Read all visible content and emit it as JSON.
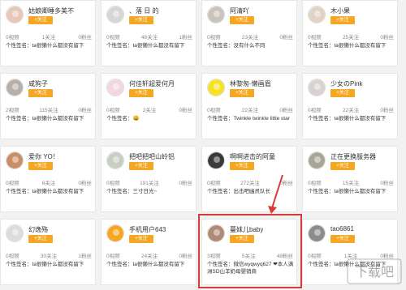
{
  "cards": [
    {
      "name": "姑娘卿睡多美不",
      "follow": "+关注",
      "views": "0视频",
      "fans": "1关注",
      "likes": "0粉丝",
      "bio": "个性签名：ta很懒什么都没有留下",
      "avatar_color": "#e8c7b8"
    },
    {
      "name": "、落 日 的",
      "follow": "+关注",
      "views": "0视频",
      "fans": "48关注",
      "likes": "1粉丝",
      "bio": "个性签名：ta很懒什么都没有留下",
      "avatar_color": "#d6d6d6"
    },
    {
      "name": "阿清吖",
      "follow": "+关注",
      "views": "0视频",
      "fans": "23关注",
      "likes": "0粉丝",
      "bio": "个性签名：没有什么不同",
      "avatar_color": "#c9c3bb"
    },
    {
      "name": "木小果",
      "follow": "+关注",
      "views": "0视频",
      "fans": "25关注",
      "likes": "0粉丝",
      "bio": "个性签名：ta很懒什么都没有留下",
      "avatar_color": "#e0d2c4"
    },
    {
      "name": "咸狗子",
      "follow": "+关注",
      "views": "2视频",
      "fans": "115关注",
      "likes": "0粉丝",
      "bio": "个性签名：ta很懒什么都没有留下",
      "avatar_color": "#b8b0a8"
    },
    {
      "name": "何佳轩超爱何月",
      "follow": "+关注",
      "views": "0视频",
      "fans": "2关注",
      "likes": "0粉丝",
      "bio": "个性签名：😀",
      "avatar_color": "#f3d7df"
    },
    {
      "name": "林黎匆-懒画眉",
      "follow": "+关注",
      "views": "0视频",
      "fans": "22关注",
      "likes": "0粉丝",
      "bio": "个性签名：Twinkle twinkle little star",
      "avatar_color": "#f5e224"
    },
    {
      "name": "少女のPink",
      "follow": "+关注",
      "views": "0视频",
      "fans": "22关注",
      "likes": "0粉丝",
      "bio": "个性签名：ta很懒什么都没有留下",
      "avatar_color": "#d9d2cf"
    },
    {
      "name": "爱你 YO！",
      "follow": "+关注",
      "views": "0视频",
      "fans": "6关注",
      "likes": "0粉丝",
      "bio": "个性签名：ta很懒什么都没有留下",
      "avatar_color": "#c98e64"
    },
    {
      "name": "把吧把吧山岭铝",
      "follow": "+关注",
      "views": "0视频",
      "fans": "191关注",
      "likes": "0粉丝",
      "bio": "个性签名：三寸日光~",
      "avatar_color": "#c8cfc0"
    },
    {
      "name": "啊啊进击的阿童",
      "follow": "+关注",
      "views": "0视频",
      "fans": "272关注",
      "likes": "0粉丝",
      "bio": "个性签名：出击吧幽灵队长",
      "avatar_color": "#3a3a3a"
    },
    {
      "name": "正在更换服务器",
      "follow": "+关注",
      "views": "0视频",
      "fans": "15关注",
      "likes": "0粉丝",
      "bio": "个性签名：ta很懒什么都没有留下",
      "avatar_color": "#a9a49a"
    },
    {
      "name": "幻逸殇",
      "follow": "+关注",
      "views": "0视频",
      "fans": "30关注",
      "likes": "1粉丝",
      "bio": "个性签名：ta很懒什么都没有留下",
      "avatar_color": "#dcdcdc"
    },
    {
      "name": "手机用户643",
      "follow": "+关注",
      "views": "0视频",
      "fans": "24关注",
      "likes": "0粉丝",
      "bio": "个性签名：ta很懒什么都没有留下",
      "avatar_color": "#f5a623"
    },
    {
      "name": "蔓妹儿baby",
      "follow": "+关注",
      "views": "3视频",
      "fans": "5关注",
      "likes": "48粉丝",
      "bio": "个性签名：微信wyqwyq627 ❤本人满洲SD山羊奶母婴销商",
      "avatar_color": "#b08a78"
    },
    {
      "name": "tao6861",
      "follow": "+关注",
      "views": "0视频",
      "fans": "1关注",
      "likes": "0粉丝",
      "bio": "个性签名：ta很懒什么都没有留下",
      "avatar_color": "#8c8c8c"
    }
  ],
  "watermark": "下载吧"
}
